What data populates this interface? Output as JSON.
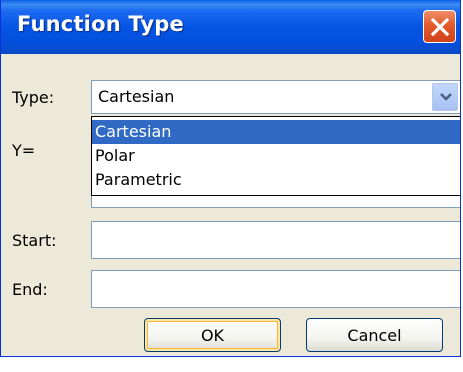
{
  "window": {
    "title": "Function Type"
  },
  "form": {
    "type_label": "Type:",
    "type_value": "Cartesian",
    "y_label": "Y=",
    "start_label": "Start:",
    "end_label": "End:"
  },
  "dropdown": {
    "options": [
      "Cartesian",
      "Polar",
      "Parametric"
    ],
    "selected": "Cartesian"
  },
  "buttons": {
    "ok": "OK",
    "cancel": "Cancel"
  },
  "icons": {
    "close": "close-icon",
    "dropdown_arrow": "chevron-down-icon"
  },
  "colors": {
    "title_bar": "#0654e4",
    "close_button": "#e35a2c",
    "selection": "#316ac5",
    "dialog_bg": "#ece9d8"
  }
}
